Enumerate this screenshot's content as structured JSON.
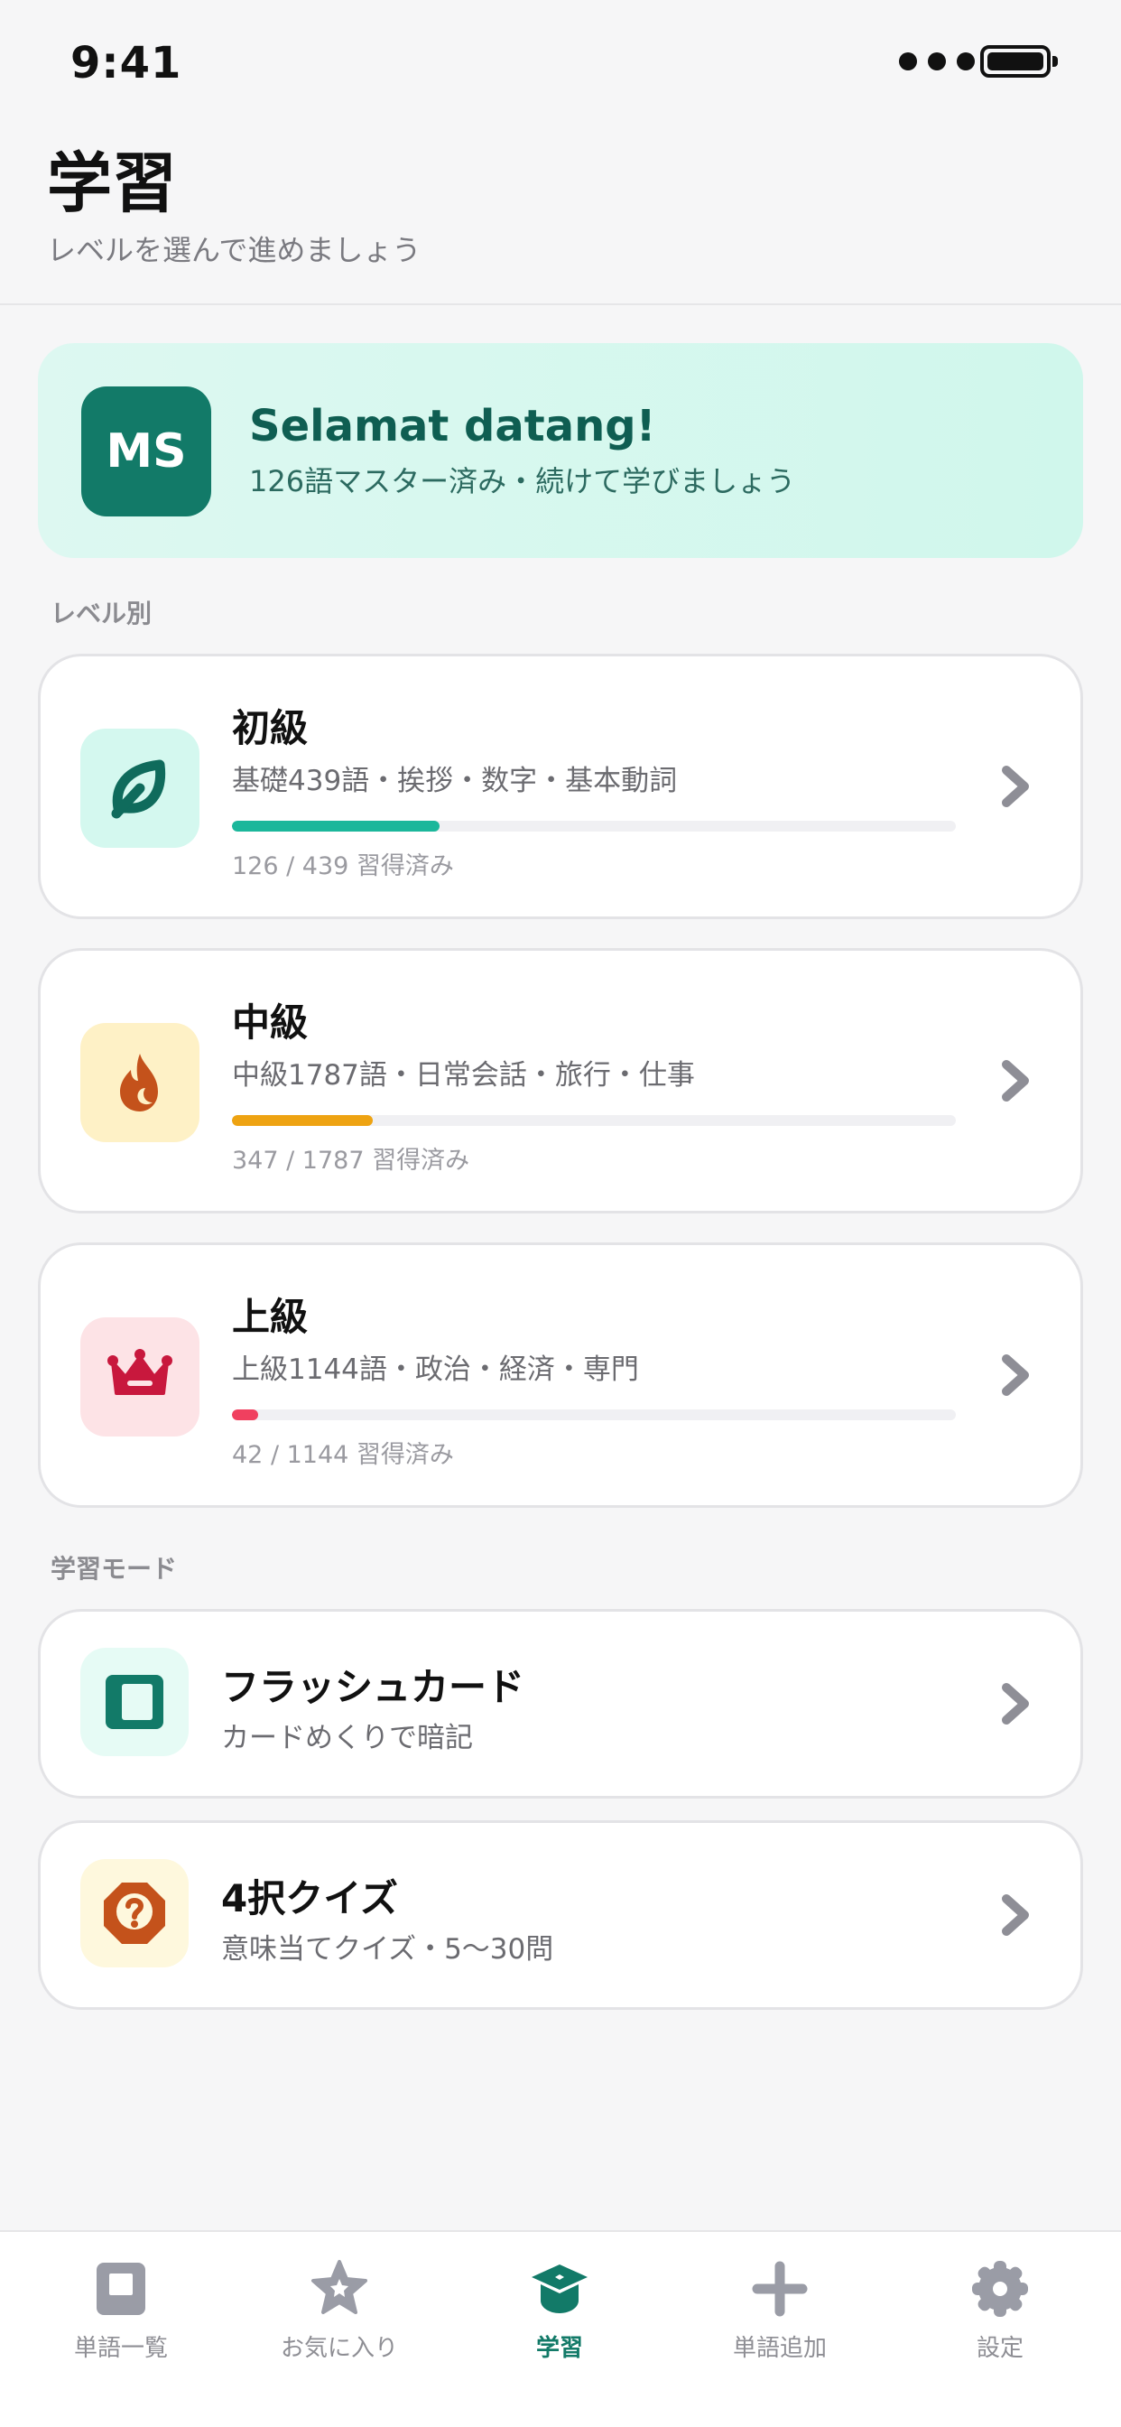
{
  "status_bar": {
    "time": "9:41"
  },
  "header": {
    "title": "学習",
    "subtitle": "レベルを選んで進めましょう"
  },
  "welcome": {
    "avatar_initials": "MS",
    "title": "Selamat datang!",
    "subtitle": "126語マスター済み・続けて学びましょう"
  },
  "sections": {
    "levels_label": "レベル別",
    "modes_label": "学習モード"
  },
  "levels": [
    {
      "title": "初級",
      "description": "基礎439語・挨拶・数字・基本動詞",
      "progress_text": "126 / 439 習得済み",
      "mastered": 126,
      "total": 439,
      "icon": "leaf-icon",
      "accent": "#1bb79b",
      "icon_bg": "#d4f8ef",
      "icon_color": "#0f6b5c"
    },
    {
      "title": "中級",
      "description": "中級1787語・日常会話・旅行・仕事",
      "progress_text": "347 / 1787 習得済み",
      "mastered": 347,
      "total": 1787,
      "icon": "flame-icon",
      "accent": "#eea312",
      "icon_bg": "#fef1c6",
      "icon_color": "#c4521b"
    },
    {
      "title": "上級",
      "description": "上級1144語・政治・経済・専門",
      "progress_text": "42 / 1144 習得済み",
      "mastered": 42,
      "total": 1144,
      "icon": "crown-icon",
      "accent": "#f0405f",
      "icon_bg": "#fde3e6",
      "icon_color": "#c8183d"
    }
  ],
  "modes": [
    {
      "title": "フラッシュカード",
      "description": "カードめくりで暗記",
      "icon": "flashcard-icon",
      "icon_bg": "#e6fbf5",
      "icon_color": "#127a68"
    },
    {
      "title": "4択クイズ",
      "description": "意味当てクイズ・5〜30問",
      "icon": "quiz-icon",
      "icon_bg": "#fef8dd",
      "icon_color": "#c4521b"
    }
  ],
  "tabbar": {
    "items": [
      {
        "label": "単語一覧",
        "icon": "word-list-icon",
        "active": false
      },
      {
        "label": "お気に入り",
        "icon": "star-icon",
        "active": false
      },
      {
        "label": "学習",
        "icon": "graduation-cap-icon",
        "active": true
      },
      {
        "label": "単語追加",
        "icon": "plus-icon",
        "active": false
      },
      {
        "label": "設定",
        "icon": "gear-icon",
        "active": false
      }
    ]
  },
  "colors": {
    "brand": "#127a68",
    "chevron": "#8e8e96",
    "tab_inactive": "#9a9ca6"
  }
}
